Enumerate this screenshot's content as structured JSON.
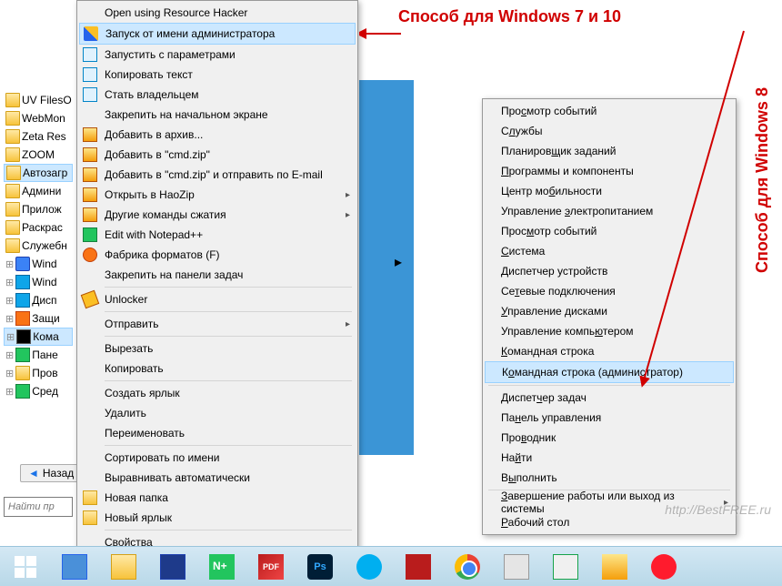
{
  "annotations": {
    "top": "Способ для Windows 7 и 10",
    "right": "Способ для Windows 8"
  },
  "watermark": "http://BestFREE.ru",
  "sidebar": {
    "items": [
      {
        "label": "UV FilesO",
        "icon": "folder"
      },
      {
        "label": "WebMon",
        "icon": "folder"
      },
      {
        "label": "Zeta Res",
        "icon": "folder"
      },
      {
        "label": "ZOOM",
        "icon": "folder"
      },
      {
        "label": "Автозагр",
        "icon": "folder",
        "selected": true
      },
      {
        "label": "Админи",
        "icon": "folder"
      },
      {
        "label": "Прилож",
        "icon": "folder"
      },
      {
        "label": "Раскрас",
        "icon": "folder"
      },
      {
        "label": "Служебн",
        "icon": "folder"
      },
      {
        "label": "Wind",
        "icon": "app"
      },
      {
        "label": "Wind",
        "icon": "blue2"
      },
      {
        "label": "Дисп",
        "icon": "blue2"
      },
      {
        "label": "Защи",
        "icon": "orange"
      },
      {
        "label": "Кома",
        "icon": "cmd",
        "selected": true
      },
      {
        "label": "Пане",
        "icon": "green"
      },
      {
        "label": "Пров",
        "icon": "folder"
      },
      {
        "label": "Сред",
        "icon": "green"
      }
    ],
    "back_label": "Назад",
    "search_placeholder": "Найти пр"
  },
  "menu1": {
    "items": [
      {
        "label": "Open using Resource Hacker",
        "icon": ""
      },
      {
        "label": "Запуск от имени администратора",
        "icon": "shield",
        "highlighted": true
      },
      {
        "label": "Запустить с параметрами",
        "icon": "doc"
      },
      {
        "label": "Копировать текст",
        "icon": "doc"
      },
      {
        "label": "Стать владельцем",
        "icon": "doc"
      },
      {
        "label": "Закрепить на начальном экране",
        "icon": ""
      },
      {
        "label": "Добавить в архив...",
        "icon": "archive"
      },
      {
        "label": "Добавить в \"cmd.zip\"",
        "icon": "archive"
      },
      {
        "label": "Добавить в \"cmd.zip\" и отправить по E-mail",
        "icon": "archive"
      },
      {
        "label": "Открыть в HaoZip",
        "icon": "archive",
        "arrow": true
      },
      {
        "label": "Другие команды сжатия",
        "icon": "archive",
        "arrow": true
      },
      {
        "label": "Edit with Notepad++",
        "icon": "np"
      },
      {
        "label": "Фабрика форматов (F)",
        "icon": "ff"
      },
      {
        "label": "Закрепить на панели задач",
        "icon": ""
      },
      {
        "sep": true
      },
      {
        "label": "Unlocker",
        "icon": "key"
      },
      {
        "sep": true
      },
      {
        "label": "Отправить",
        "icon": "",
        "arrow": true
      },
      {
        "sep": true
      },
      {
        "label": "Вырезать",
        "icon": ""
      },
      {
        "label": "Копировать",
        "icon": ""
      },
      {
        "sep": true
      },
      {
        "label": "Создать ярлык",
        "icon": ""
      },
      {
        "label": "Удалить",
        "icon": ""
      },
      {
        "label": "Переименовать",
        "icon": ""
      },
      {
        "sep": true
      },
      {
        "label": "Сортировать по имени",
        "icon": ""
      },
      {
        "label": "Выравнивать автоматически",
        "icon": ""
      },
      {
        "label": "Новая папка",
        "icon": "folder2"
      },
      {
        "label": "Новый ярлык",
        "icon": "folder2"
      },
      {
        "sep": true
      },
      {
        "label": "Свойства",
        "icon": ""
      }
    ]
  },
  "menu2": {
    "groups": [
      [
        {
          "label": "Просмотр событий",
          "u": "с"
        },
        {
          "label": "Службы",
          "u": "л"
        },
        {
          "label": "Планировщик заданий",
          "u": "щ"
        },
        {
          "label": "Программы и компоненты",
          "u": "П"
        },
        {
          "label": "Центр мобильности",
          "u": "б"
        },
        {
          "label": "Управление электропитанием",
          "u": "э"
        },
        {
          "label": "Просмотр событий",
          "u": "м"
        },
        {
          "label": "Система",
          "u": "С"
        },
        {
          "label": "Диспетчер устройств",
          "u": "Д"
        },
        {
          "label": "Сетевые подключения",
          "u": "т"
        },
        {
          "label": "Управление дисками",
          "u": "У"
        },
        {
          "label": "Управление компьютером",
          "u": "ю"
        },
        {
          "label": "Командная строка",
          "u": "К"
        },
        {
          "label": "Командная строка (администратор)",
          "u": "о",
          "highlighted": true
        }
      ],
      [
        {
          "label": "Диспетчер задач",
          "u": "ч"
        },
        {
          "label": "Панель управления",
          "u": "н"
        },
        {
          "label": "Проводник",
          "u": "в"
        },
        {
          "label": "Найти",
          "u": "й"
        },
        {
          "label": "Выполнить",
          "u": "ы"
        }
      ],
      [
        {
          "label": "Завершение работы или выход из системы",
          "u": "З",
          "arrow": true
        },
        {
          "label": "Рабочий стол",
          "u": "Р"
        }
      ]
    ]
  },
  "taskbar": {
    "items": [
      "start",
      "calc",
      "explorer",
      "save",
      "notepad",
      "pdf",
      "ps",
      "skype",
      "mosaic",
      "chrome",
      "text",
      "mon",
      "tc",
      "opera"
    ]
  }
}
